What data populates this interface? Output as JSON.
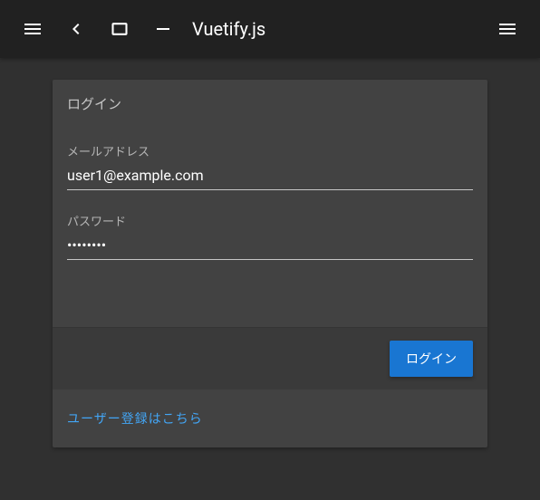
{
  "toolbar": {
    "title": "Vuetify.js"
  },
  "card": {
    "title": "ログイン",
    "email_label": "メールアドレス",
    "email_value": "user1@example.com",
    "password_label": "パスワード",
    "password_value": "password",
    "login_button": "ログイン",
    "register_link": "ユーザー登録はこちら"
  }
}
